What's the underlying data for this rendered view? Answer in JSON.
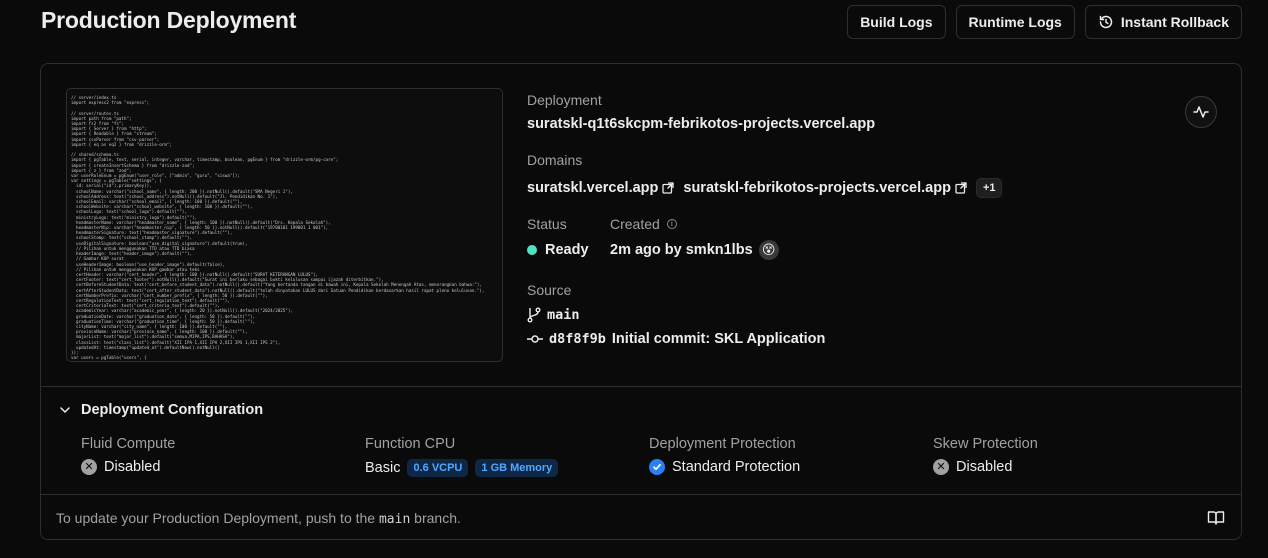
{
  "header": {
    "title": "Production Deployment",
    "buttons": {
      "build_logs": "Build Logs",
      "runtime_logs": "Runtime Logs",
      "instant_rollback": "Instant Rollback"
    }
  },
  "deployment": {
    "label": "Deployment",
    "url": "suratskl-q1t6skcpm-febrikotos-projects.vercel.app"
  },
  "domains": {
    "label": "Domains",
    "items": [
      "suratskl.vercel.app",
      "suratskl-febrikotos-projects.vercel.app"
    ],
    "more_badge": "+1"
  },
  "status": {
    "label": "Status",
    "value": "Ready",
    "color": "#50e3c2"
  },
  "created": {
    "label": "Created",
    "value": "2m ago by smkn1lbs"
  },
  "source": {
    "label": "Source",
    "branch": "main",
    "commit_hash": "d8f8f9b",
    "commit_message": "Initial commit: SKL Application"
  },
  "preview": {
    "code": "// server/index.ts\nimport express2 from \"express\";\n\n// server/routes.ts\nimport path from \"path\";\nimport fs2 from \"fs\";\nimport { Server } from \"http\";\nimport { Readable } from \"stream\";\nimport csvParser from \"csv-parser\";\nimport { eq as eq2 } from \"drizzle-orm\";\n\n// shared/schema.ts\nimport { pgTable, text, serial, integer, varchar, timestamp, boolean, pgEnum } from \"drizzle-orm/pg-core\";\nimport { createInsertSchema } from \"drizzle-zod\";\nimport { z } from \"zod\";\nvar userRoleEnum = pgEnum(\"user_role\", [\"admin\", \"guru\", \"siswa\"]);\nvar settings = pgTable(\"settings\", {\n  id: serial(\"id\").primaryKey(),\n  schoolName: varchar(\"school_name\", { length: 200 }).notNull().default(\"SMA Negeri 1\"),\n  schoolAddress: text(\"school_address\").notNull().default(\"Jl. Pendidikan No. 1\"),\n  schoolEmail: varchar(\"school_email\", { length: 100 }).default(\"\"),\n  schoolWebsite: varchar(\"school_website\", { length: 100 }).default(\"\"),\n  schoolLogo: text(\"school_logo\").default(\"\"),\n  ministryLogo: text(\"ministry_logo\").default(\"\"),\n  headmasterName: varchar(\"headmaster_name\", { length: 100 }).notNull().default(\"Drs. Kepala Sekolah\"),\n  headmasterNip: varchar(\"headmaster_nip\", { length: 50 }).notNull().default(\"19700101 199801 1 001\"),\n  headmasterSignature: text(\"headmaster_signature\").default(\"\"),\n  schoolStamp: text(\"school_stamp\").default(\"\"),\n  useDigitalSignature: boolean(\"use_digital_signature\").default(true),\n  // Pilihan untuk menggunakan TTD atau TTD biasa\n  headerImage: text(\"header_image\").default(\"\"),\n  // Gambar KOP surat\n  useHeaderImage: boolean(\"use_header_image\").default(false),\n  // Pilihan untuk menggunakan KOP gambar atau teks\n  certHeader: varchar(\"cert_header\", { length: 100 }).notNull().default(\"SURAT KETERANGAN LULUS\"),\n  certFooter: text(\"cert_footer\").notNull().default(\"Surat ini berlaku sebagai bukti kelulusan sampai ijazah diterbitkan.\"),\n  certBeforeStudentData: text(\"cert_before_student_data\").notNull().default(\"Yang bertanda tangan di bawah ini, Kepala Sekolah Menengah Atas, menerangkan bahwa:\"),\n  certAfterStudentData: text(\"cert_after_student_data\").notNull().default(\"telah dinyatakan LULUS dari Satuan Pendidikan berdasarkan hasil rapat pleno kelulusan.\"),\n  certNumberPrefix: varchar(\"cert_number_prefix\", { length: 50 }).default(\"\"),\n  certRegulationText: text(\"cert_regulation_text\").default(\"\"),\n  certCriteriaText: text(\"cert_criteria_text\").default(\"\"),\n  academicYear: varchar(\"academic_year\", { length: 20 }).notNull().default(\"2024/2025\"),\n  graduationDate: varchar(\"graduation_date\", { length: 50 }).default(\"\"),\n  graduationTime: varchar(\"graduation_time\", { length: 50 }).default(\"\"),\n  cityName: varchar(\"city_name\", { length: 100 }).default(\"\"),\n  provinceName: varchar(\"province_name\", { length: 100 }).default(\"\"),\n  majorList: text(\"major_list\").default(\"semua,MIPA,IPS,BAHASA\"),\n  classList: text(\"class_list\").default(\"XII IPA 1,XII IPA 2,XII IPS 1,XII IPS 2\"),\n  updatedAt: timestamp(\"updated_at\").defaultNow().notNull()\n});\nvar users = pgTable(\"users\", {"
  },
  "config": {
    "title": "Deployment Configuration",
    "fluid_compute": {
      "label": "Fluid Compute",
      "value": "Disabled"
    },
    "function_cpu": {
      "label": "Function CPU",
      "value": "Basic",
      "vcpu": "0.6 VCPU",
      "memory": "1 GB Memory"
    },
    "deployment_protection": {
      "label": "Deployment Protection",
      "value": "Standard Protection"
    },
    "skew_protection": {
      "label": "Skew Protection",
      "value": "Disabled"
    }
  },
  "footer": {
    "text_before": "To update your Production Deployment, push to the ",
    "branch": "main",
    "text_after": " branch."
  },
  "colors": {
    "background": "#0a0a0a",
    "border": "#2e2e2e",
    "ready": "#50e3c2",
    "accent_blue": "#2a7ff6"
  }
}
